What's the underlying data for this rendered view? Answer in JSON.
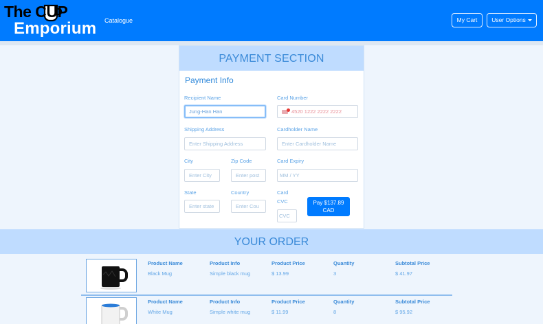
{
  "navbar": {
    "logo_line1_pre": "The C",
    "logo_line1_mid": "U",
    "logo_line1_post": "P",
    "logo_line2": "Emporium",
    "catalogue_link": "Catalogue",
    "cart_button": "My Cart",
    "user_options_button": "User Options",
    "brand_color": "#007bff"
  },
  "payment": {
    "section_title": "PAYMENT SECTION",
    "subtitle": "Payment Info",
    "recipient": {
      "label": "Recipient Name",
      "value": "Jung-Han Han"
    },
    "shipping": {
      "label": "Shipping Address",
      "placeholder": "Enter Shipping Address"
    },
    "city": {
      "label": "City",
      "placeholder": "Enter City"
    },
    "zip": {
      "label": "Zip Code",
      "placeholder": "Enter post"
    },
    "state": {
      "label": "State",
      "placeholder": "Enter state"
    },
    "country": {
      "label": "Country",
      "placeholder": "Enter Cou"
    },
    "card_number": {
      "label": "Card Number",
      "placeholder": "4520 1222 2222 2222"
    },
    "cardholder": {
      "label": "Cardholder Name",
      "placeholder": "Enter Cardholder Name"
    },
    "expiry": {
      "label": "Card Expiry",
      "placeholder": "MM / YY"
    },
    "cvc": {
      "label_line1": "Card",
      "label_line2": "CVC",
      "placeholder": "CVC"
    },
    "pay_button_line1": "Pay $137.89",
    "pay_button_line2": "CAD"
  },
  "order": {
    "section_title": "YOUR ORDER",
    "columns": [
      "Product Name",
      "Product Info",
      "Product Price",
      "Quantity",
      "Subtotal Price"
    ],
    "items": [
      {
        "name": "Black Mug",
        "info": "Simple black mug",
        "price": "$ 13.99",
        "quantity": "3",
        "subtotal": "$ 41.97",
        "mug_color": "#111111"
      },
      {
        "name": "White Mug",
        "info": "Simple white mug",
        "price": "$ 11.99",
        "quantity": "8",
        "subtotal": "$ 95.92",
        "mug_color": "#f4f4f4"
      }
    ]
  }
}
